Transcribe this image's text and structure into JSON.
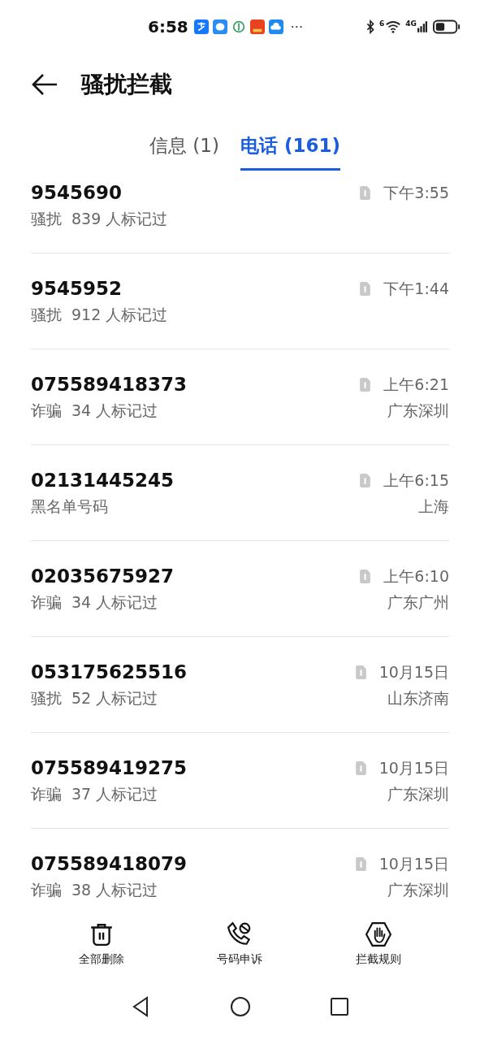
{
  "status_bar": {
    "time": "6:58",
    "more": "···",
    "wifi_label": "6",
    "signal_label": "4G"
  },
  "header": {
    "title": "骚扰拦截"
  },
  "tabs": [
    {
      "label": "信息 (1)",
      "selected": false
    },
    {
      "label": "电话 (161)",
      "selected": true
    }
  ],
  "calls": [
    {
      "number": "9545690",
      "tag": "骚扰",
      "marks": "839 人标记过",
      "time": "下午3:55"
    },
    {
      "number": "9545952",
      "tag": "骚扰",
      "marks": "912 人标记过",
      "time": "下午1:44"
    },
    {
      "number": "075589418373",
      "tag": "诈骗",
      "marks": "34 人标记过",
      "time": "上午6:21",
      "location": "广东深圳"
    },
    {
      "number": "02131445245",
      "tag": "黑名单号码",
      "time": "上午6:15",
      "location": "上海"
    },
    {
      "number": "02035675927",
      "tag": "诈骗",
      "marks": "34 人标记过",
      "time": "上午6:10",
      "location": "广东广州"
    },
    {
      "number": "053175625516",
      "tag": "骚扰",
      "marks": "52 人标记过",
      "time": "10月15日",
      "location": "山东济南"
    },
    {
      "number": "075589419275",
      "tag": "诈骗",
      "marks": "37 人标记过",
      "time": "10月15日",
      "location": "广东深圳"
    },
    {
      "number": "075589418079",
      "tag": "诈骗",
      "marks": "38 人标记过",
      "time": "10月15日",
      "location": "广东深圳"
    }
  ],
  "toolbar": [
    {
      "kind": "trash",
      "label": "全部删除"
    },
    {
      "kind": "appeal",
      "label": "号码申诉"
    },
    {
      "kind": "rules",
      "label": "拦截规则"
    }
  ]
}
